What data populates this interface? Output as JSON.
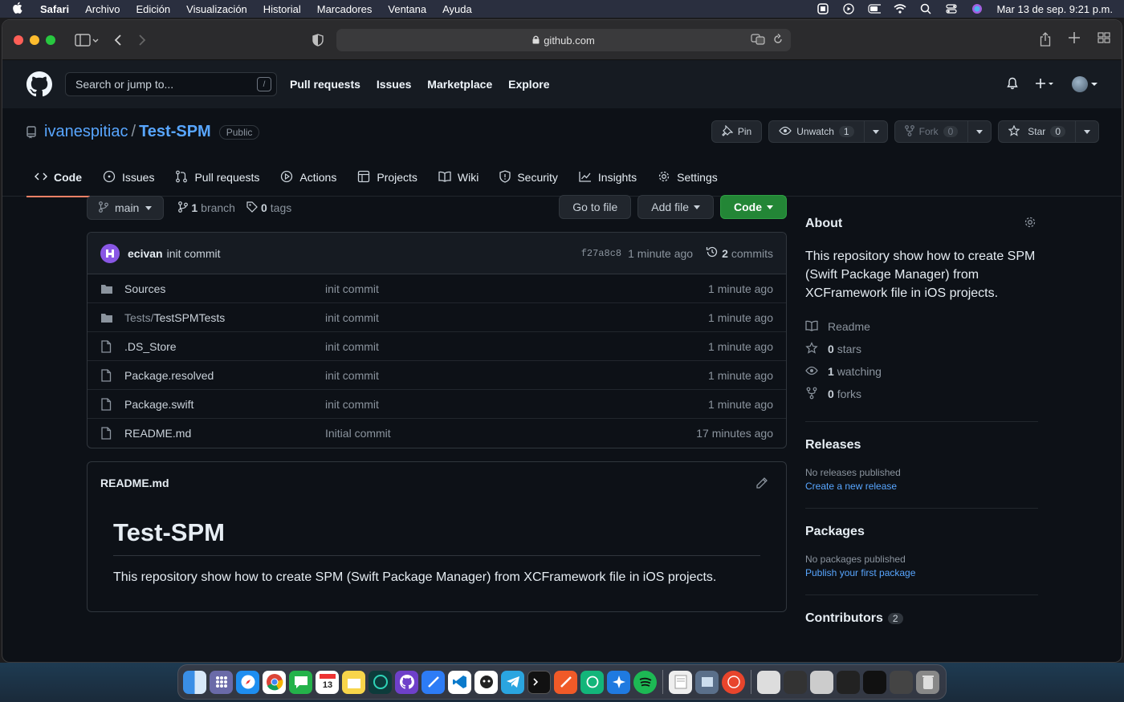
{
  "menubar": {
    "app": "Safari",
    "items": [
      "Archivo",
      "Edición",
      "Visualización",
      "Historial",
      "Marcadores",
      "Ventana",
      "Ayuda"
    ],
    "clock": "Mar 13 de sep.  9:21 p.m."
  },
  "browser": {
    "url": "github.com"
  },
  "header": {
    "search_placeholder": "Search or jump to...",
    "slash_key": "/",
    "nav": [
      "Pull requests",
      "Issues",
      "Marketplace",
      "Explore"
    ]
  },
  "repo": {
    "owner": "ivanespitiac",
    "separator": "/",
    "name": "Test-SPM",
    "visibility": "Public",
    "pin_label": "Pin",
    "unwatch_label": "Unwatch",
    "watch_count": "1",
    "fork_label": "Fork",
    "fork_count": "0",
    "star_label": "Star",
    "star_count": "0",
    "tabs": [
      "Code",
      "Issues",
      "Pull requests",
      "Actions",
      "Projects",
      "Wiki",
      "Security",
      "Insights",
      "Settings"
    ]
  },
  "code": {
    "branch_name": "main",
    "branch_count": "1",
    "branch_word": "branch",
    "tag_count": "0",
    "tag_word": "tags",
    "go_to_file": "Go to file",
    "add_file": "Add file",
    "code_button": "Code",
    "commit": {
      "author": "ecivan",
      "message": "init commit",
      "sha": "f27a8c8",
      "age": "1 minute ago",
      "count": "2",
      "count_word": "commits"
    },
    "files": [
      {
        "prefix": "",
        "name": "Sources",
        "type": "folder",
        "message": "init commit",
        "age": "1 minute ago"
      },
      {
        "prefix": "Tests/",
        "name": "TestSPMTests",
        "type": "folder",
        "message": "init commit",
        "age": "1 minute ago"
      },
      {
        "prefix": "",
        "name": ".DS_Store",
        "type": "file",
        "message": "init commit",
        "age": "1 minute ago"
      },
      {
        "prefix": "",
        "name": "Package.resolved",
        "type": "file",
        "message": "init commit",
        "age": "1 minute ago"
      },
      {
        "prefix": "",
        "name": "Package.swift",
        "type": "file",
        "message": "init commit",
        "age": "1 minute ago"
      },
      {
        "prefix": "",
        "name": "README.md",
        "type": "file",
        "message": "Initial commit",
        "age": "17 minutes ago"
      }
    ]
  },
  "readme": {
    "filename": "README.md",
    "heading": "Test-SPM",
    "body": "This repository show how to create SPM (Swift Package Manager) from XCFramework file in iOS projects."
  },
  "sidebar": {
    "about_title": "About",
    "about_text": "This repository show how to create SPM (Swift Package Manager) from XCFramework file in iOS projects.",
    "readme_link": "Readme",
    "stars_count": "0",
    "stars_word": "stars",
    "watching_count": "1",
    "watching_word": "watching",
    "forks_count": "0",
    "forks_word": "forks",
    "releases_title": "Releases",
    "releases_none": "No releases published",
    "releases_link": "Create a new release",
    "packages_title": "Packages",
    "packages_none": "No packages published",
    "packages_link": "Publish your first package",
    "contributors_title": "Contributors",
    "contributors_count": "2"
  },
  "colors": {
    "accent_link": "#58a6ff",
    "code_button": "#238636",
    "tab_underline": "#f78166"
  }
}
